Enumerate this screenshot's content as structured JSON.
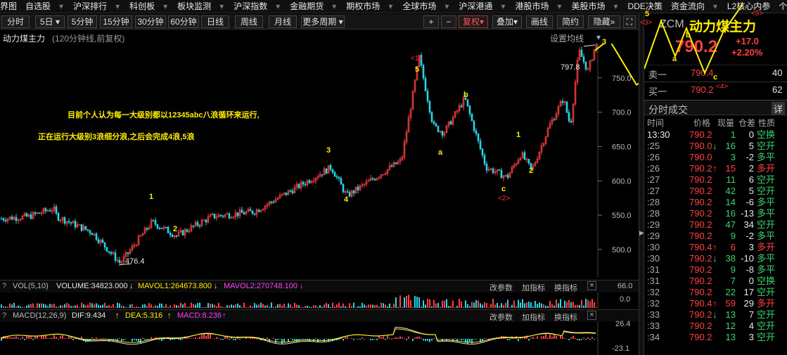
{
  "menu": {
    "items": [
      "界图",
      "自选股",
      "沪深排行",
      "科创板",
      "板块监测",
      "沪深指数",
      "金融期货",
      "期权市场",
      "全球市场",
      "沪深港通",
      "港股市场",
      "美股市场",
      "DDE决策",
      "资金流向",
      "L2核心内参",
      "个股风云"
    ]
  },
  "toolbar": {
    "periods": [
      "分时",
      "5日",
      "5分钟",
      "15分钟",
      "30分钟",
      "60分钟",
      "日线",
      "周线",
      "月线",
      "更多周期"
    ],
    "right_buttons": [
      "+",
      "−",
      "复权",
      "叠加",
      "画线",
      "简约",
      "隐藏"
    ]
  },
  "chart": {
    "name": "动力煤主力",
    "subtitle": "(120分钟线,前复权)",
    "settings_label": "设置均线",
    "annotation_line1": "目前个人认为每一大级别都以12345abc八浪循环来运行,",
    "annotation_line2": "正在运行大级别3浪细分浪,之后会完成4浪,5浪",
    "high_label": "797.8",
    "low_label": "476.4",
    "y_ticks": [
      "750.0",
      "700.0",
      "650.0",
      "600.0",
      "550.0",
      "500.0"
    ],
    "wave_labels": {
      "w1": "1",
      "w2": "2",
      "w3": "3",
      "w4": "4",
      "w5": "5",
      "wa": "a",
      "wb": "b",
      "wc": "c",
      "w1b": "1",
      "w2b": "2",
      "w3b": "3",
      "w4b": "4"
    },
    "wave_refs": {
      "r1": "<1>",
      "r2": "<2>",
      "r3": "<3>",
      "r4": "<4>",
      "r5": "<5>"
    }
  },
  "volume": {
    "title": "VOL(5,10)",
    "volume": "VOLUME:34823.000",
    "mavol1": "MAVOL1:264673.800",
    "mavol2": "MAVOL2:270748.100",
    "btn_params": "改参数",
    "btn_add": "加指标",
    "btn_switch": "换指标",
    "y_top": "66.0",
    "y_bottom": "0.0"
  },
  "macd": {
    "title": "MACD(12,26,9)",
    "dif": "DIF:9.434",
    "dea": "DEA:5.316",
    "macd": "MACD:8.236",
    "btn_params": "改参数",
    "btn_add": "加指标",
    "btn_switch": "换指标",
    "y_top": "26.4",
    "y_bottom": "-23.1"
  },
  "quote": {
    "code": "ZCM",
    "name": "动力煤主力",
    "price": "790.2",
    "change": "+17.0",
    "change_pct": "+2.20%",
    "sell1_label": "卖一",
    "sell1_price": "790.4",
    "sell1_vol": "40",
    "buy1_label": "买一",
    "buy1_price": "790.2",
    "buy1_vol": "62",
    "trades_title": "分时成交",
    "detail_btn": "详",
    "headers": [
      "时间",
      "价格",
      "现量",
      "仓差",
      "性质"
    ]
  },
  "ticks": [
    {
      "time": "13:30",
      "price": "790.2",
      "arrow": "",
      "vol": "1",
      "diff": "0",
      "type": "空换",
      "pc": "up",
      "vc": "dn",
      "tc": "dn"
    },
    {
      "time": ":25",
      "price": "790.0",
      "arrow": "↓",
      "vol": "16",
      "diff": "5",
      "type": "空开",
      "pc": "up",
      "vc": "dn",
      "tc": "dn"
    },
    {
      "time": ":26",
      "price": "790.0",
      "arrow": "",
      "vol": "3",
      "diff": "-2",
      "type": "多平",
      "pc": "up",
      "vc": "dn",
      "tc": "dn"
    },
    {
      "time": ":26",
      "price": "790.2",
      "arrow": "↑",
      "vol": "15",
      "diff": "2",
      "type": "多开",
      "pc": "up",
      "vc": "up",
      "tc": "up"
    },
    {
      "time": ":27",
      "price": "790.2",
      "arrow": "",
      "vol": "11",
      "diff": "6",
      "type": "空开",
      "pc": "up",
      "vc": "dn",
      "tc": "dn"
    },
    {
      "time": ":27",
      "price": "790.2",
      "arrow": "",
      "vol": "42",
      "diff": "5",
      "type": "空开",
      "pc": "up",
      "vc": "dn",
      "tc": "dn"
    },
    {
      "time": ":28",
      "price": "790.2",
      "arrow": "",
      "vol": "14",
      "diff": "-6",
      "type": "多平",
      "pc": "up",
      "vc": "dn",
      "tc": "dn"
    },
    {
      "time": ":28",
      "price": "790.2",
      "arrow": "",
      "vol": "16",
      "diff": "-13",
      "type": "多平",
      "pc": "up",
      "vc": "dn",
      "tc": "dn"
    },
    {
      "time": ":29",
      "price": "790.2",
      "arrow": "",
      "vol": "47",
      "diff": "34",
      "type": "空开",
      "pc": "up",
      "vc": "dn",
      "tc": "dn"
    },
    {
      "time": ":29",
      "price": "790.2",
      "arrow": "",
      "vol": "9",
      "diff": "-2",
      "type": "多平",
      "pc": "up",
      "vc": "dn",
      "tc": "dn"
    },
    {
      "time": ":30",
      "price": "790.4",
      "arrow": "↑",
      "vol": "6",
      "diff": "3",
      "type": "多开",
      "pc": "up",
      "vc": "up",
      "tc": "up"
    },
    {
      "time": ":30",
      "price": "790.2",
      "arrow": "↓",
      "vol": "38",
      "diff": "-10",
      "type": "多平",
      "pc": "up",
      "vc": "dn",
      "tc": "dn"
    },
    {
      "time": ":31",
      "price": "790.2",
      "arrow": "",
      "vol": "9",
      "diff": "-8",
      "type": "多平",
      "pc": "up",
      "vc": "dn",
      "tc": "dn"
    },
    {
      "time": ":31",
      "price": "790.2",
      "arrow": "",
      "vol": "7",
      "diff": "0",
      "type": "空换",
      "pc": "up",
      "vc": "dn",
      "tc": "dn"
    },
    {
      "time": ":32",
      "price": "790.2",
      "arrow": "",
      "vol": "22",
      "diff": "17",
      "type": "空开",
      "pc": "up",
      "vc": "dn",
      "tc": "dn"
    },
    {
      "time": ":32",
      "price": "790.4",
      "arrow": "↑",
      "vol": "59",
      "diff": "29",
      "type": "多开",
      "pc": "up",
      "vc": "up",
      "tc": "up"
    },
    {
      "time": ":33",
      "price": "790.2",
      "arrow": "↓",
      "vol": "13",
      "diff": "7",
      "type": "空开",
      "pc": "up",
      "vc": "dn",
      "tc": "dn"
    },
    {
      "time": ":33",
      "price": "790.2",
      "arrow": "",
      "vol": "12",
      "diff": "4",
      "type": "空开",
      "pc": "up",
      "vc": "dn",
      "tc": "dn"
    },
    {
      "time": ":34",
      "price": "790.2",
      "arrow": "",
      "vol": "13",
      "diff": "3",
      "type": "空开",
      "pc": "up",
      "vc": "dn",
      "tc": "dn"
    }
  ],
  "colors": {
    "up": "#ff4040",
    "down": "#3bd36a",
    "cyan": "#27d6e6",
    "yellow": "#ffee00",
    "magenta": "#ff40ff"
  }
}
